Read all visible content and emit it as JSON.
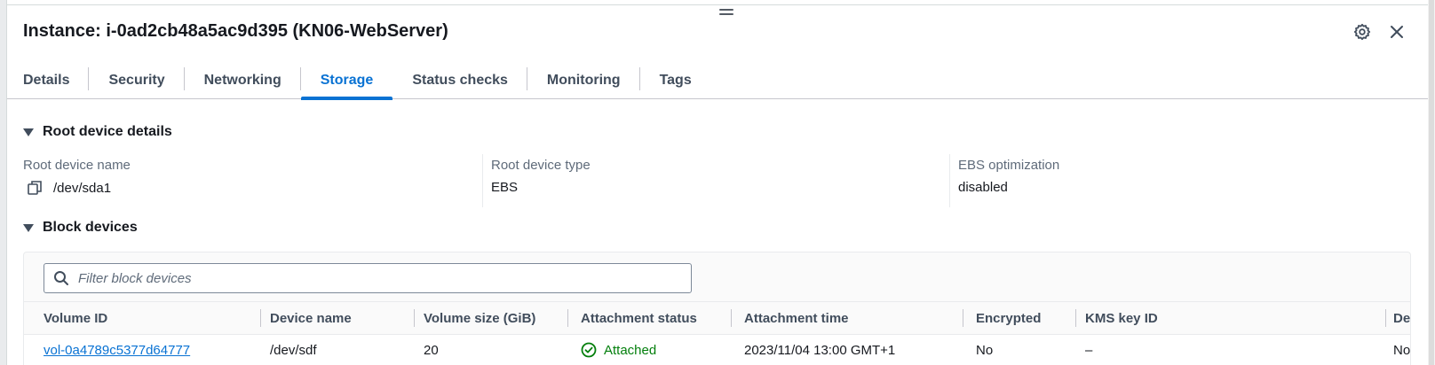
{
  "panel": {
    "title": "Instance: i-0ad2cb48a5ac9d395 (KN06-WebServer)"
  },
  "icons": {
    "drag": "drag-handle-icon",
    "settings": "gear-icon",
    "close": "close-icon",
    "copy": "copy-icon",
    "search": "search-icon",
    "status": "check-circle-icon",
    "expand": "caret-down-icon"
  },
  "tabs": [
    {
      "label": "Details"
    },
    {
      "label": "Security"
    },
    {
      "label": "Networking"
    },
    {
      "label": "Storage",
      "active": true
    },
    {
      "label": "Status checks"
    },
    {
      "label": "Monitoring"
    },
    {
      "label": "Tags"
    }
  ],
  "root_device": {
    "section_label": "Root device details",
    "fields": [
      {
        "label": "Root device name",
        "value": "/dev/sda1"
      },
      {
        "label": "Root device type",
        "value": "EBS"
      },
      {
        "label": "EBS optimization",
        "value": "disabled"
      }
    ]
  },
  "block_devices": {
    "section_label": "Block devices",
    "filter_placeholder": "Filter block devices",
    "filter_value": "",
    "columns": [
      "Volume ID",
      "Device name",
      "Volume size (GiB)",
      "Attachment status",
      "Attachment time",
      "Encrypted",
      "KMS key ID",
      "Delete"
    ],
    "rows": [
      {
        "volume_id": "vol-0a4789c5377d64777",
        "device_name": "/dev/sdf",
        "volume_size": "20",
        "attachment_status": "Attached",
        "attachment_time": "2023/11/04 13:00 GMT+1",
        "encrypted": "No",
        "kms_key_id": "–",
        "delete_on_termination": "No"
      }
    ]
  },
  "colors": {
    "accent": "#0972d3",
    "success": "#037f0c",
    "text": "#16191f",
    "muted": "#5f6b7a"
  }
}
